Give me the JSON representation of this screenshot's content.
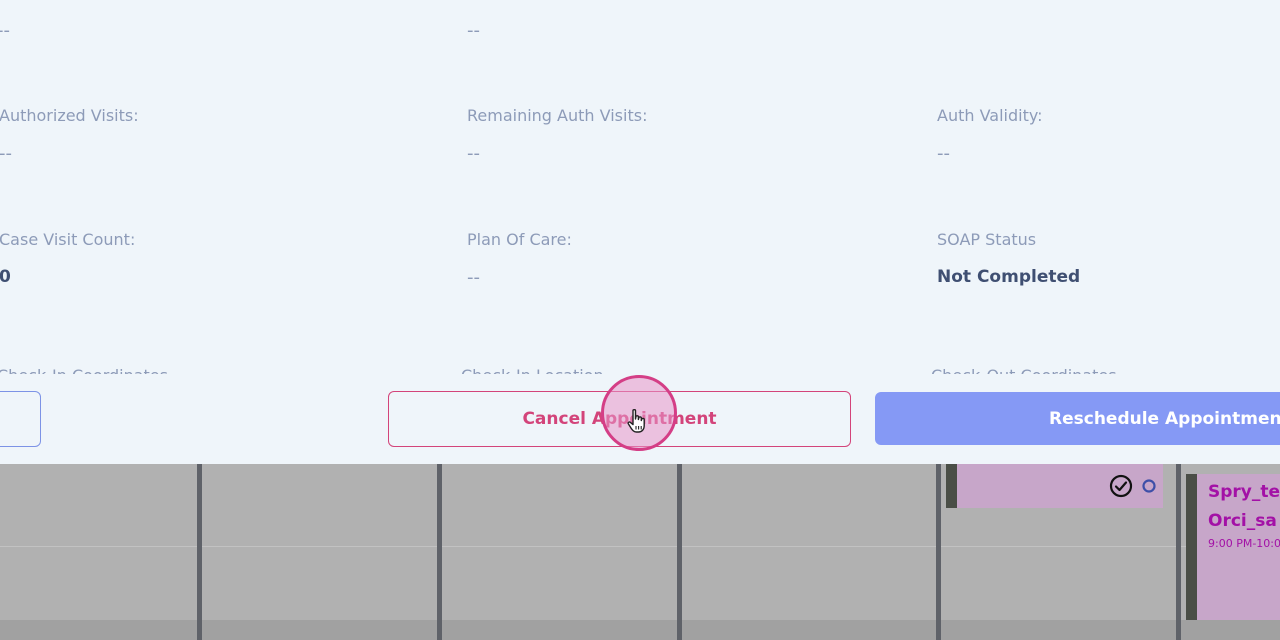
{
  "fields": {
    "row0": {
      "col1_value": "--",
      "col2_value": "--"
    },
    "authorized_visits": {
      "label": "Authorized Visits:",
      "value": "--"
    },
    "remaining_auth_visits": {
      "label": "Remaining Auth Visits:",
      "value": "--"
    },
    "auth_validity": {
      "label": "Auth Validity:",
      "value": "--"
    },
    "case_visit_count": {
      "label": "Case Visit Count:",
      "value": "0"
    },
    "plan_of_care": {
      "label": "Plan Of Care:",
      "value": "--"
    },
    "soap_status": {
      "label": "SOAP Status",
      "value": "Not Completed"
    },
    "check_in_coordinates": {
      "label": "Check-In Coordinates"
    },
    "check_in_location": {
      "label": "Check-In Location"
    },
    "check_out_coordinates": {
      "label": "Check-Out Coordinates"
    }
  },
  "actions": {
    "cancel_label": "Cancel Appointment",
    "reschedule_label": "Reschedule Appointment"
  },
  "calendar": {
    "appointment": {
      "line1": "Spry_te",
      "line2": "Orci_sa",
      "time": "9:00 PM-10:0"
    }
  },
  "icons": {
    "status_check": "check-circle-icon",
    "status_dot": "circle-icon",
    "cursor": "hand-pointer-icon"
  },
  "colors": {
    "accent_pink": "#d3447a",
    "primary_blue": "#8599f5",
    "appointment_text": "#a311a6",
    "appointment_bg": "#c7a6c9"
  }
}
